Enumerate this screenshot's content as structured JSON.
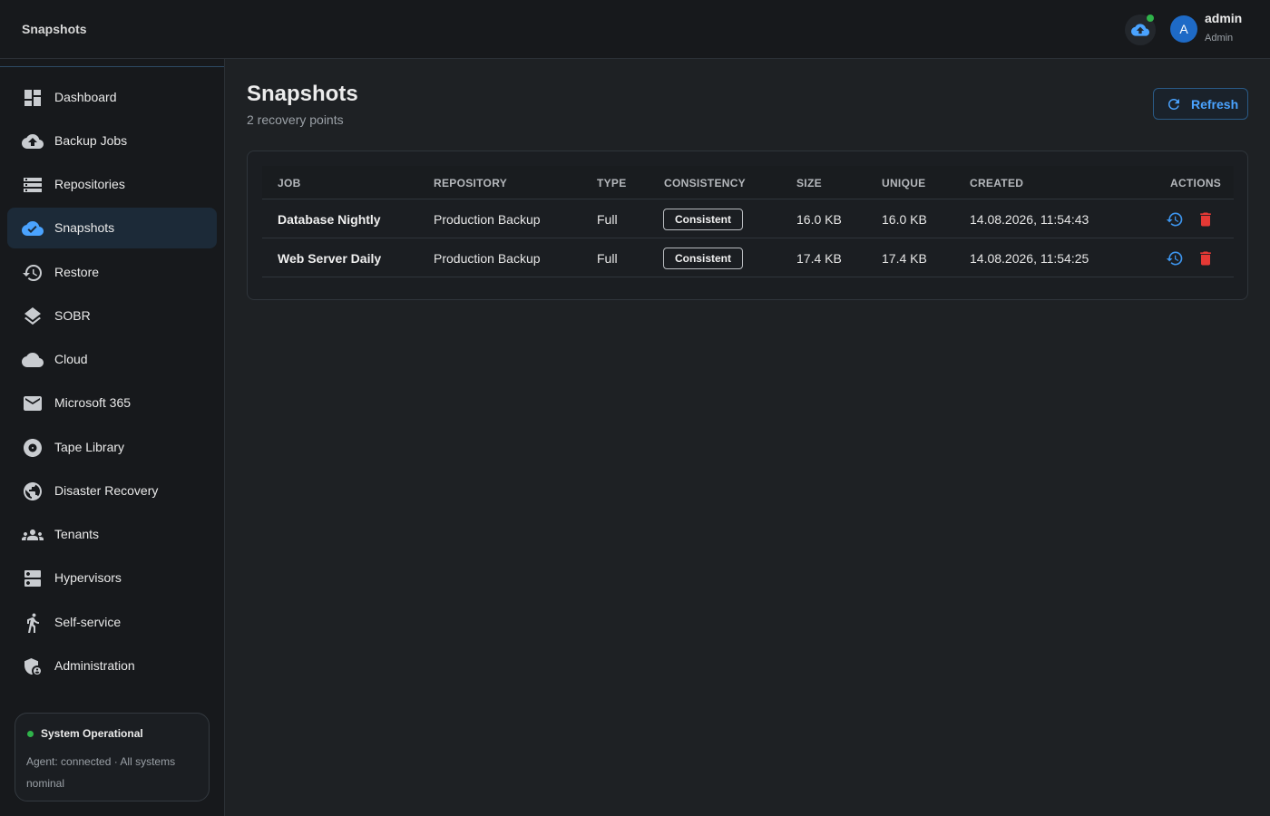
{
  "app": {
    "title": "Snapshots"
  },
  "header": {
    "user_initial": "A",
    "user_name": "admin",
    "user_role": "Admin"
  },
  "sidebar": {
    "items": [
      {
        "label": "Dashboard",
        "icon": "dashboard-icon",
        "active": false
      },
      {
        "label": "Backup Jobs",
        "icon": "cloud-upload-icon",
        "active": false
      },
      {
        "label": "Repositories",
        "icon": "storage-icon",
        "active": false
      },
      {
        "label": "Snapshots",
        "icon": "cloud-check-icon",
        "active": true
      },
      {
        "label": "Restore",
        "icon": "history-icon",
        "active": false
      },
      {
        "label": "SOBR",
        "icon": "layers-icon",
        "active": false
      },
      {
        "label": "Cloud",
        "icon": "cloud-icon",
        "active": false
      },
      {
        "label": "Microsoft 365",
        "icon": "mail-icon",
        "active": false
      },
      {
        "label": "Tape Library",
        "icon": "disc-icon",
        "active": false
      },
      {
        "label": "Disaster Recovery",
        "icon": "globe-icon",
        "active": false
      },
      {
        "label": "Tenants",
        "icon": "groups-icon",
        "active": false
      },
      {
        "label": "Hypervisors",
        "icon": "server-icon",
        "active": false
      },
      {
        "label": "Self-service",
        "icon": "person-icon",
        "active": false
      },
      {
        "label": "Administration",
        "icon": "admin-shield-icon",
        "active": false
      }
    ],
    "status": {
      "title": "System Operational",
      "description": "Agent: connected · All systems nominal"
    }
  },
  "main": {
    "title": "Snapshots",
    "subtitle": "2 recovery points",
    "refresh_label": "Refresh",
    "table": {
      "columns": [
        "JOB",
        "REPOSITORY",
        "TYPE",
        "CONSISTENCY",
        "SIZE",
        "UNIQUE",
        "CREATED",
        "ACTIONS"
      ],
      "rows": [
        {
          "job": "Database Nightly",
          "repository": "Production Backup",
          "type": "Full",
          "consistency": "Consistent",
          "size": "16.0 KB",
          "unique": "16.0 KB",
          "created": "14.08.2026, 11:54:43"
        },
        {
          "job": "Web Server Daily",
          "repository": "Production Backup",
          "type": "Full",
          "consistency": "Consistent",
          "size": "17.4 KB",
          "unique": "17.4 KB",
          "created": "14.08.2026, 11:54:25"
        }
      ]
    }
  },
  "colors": {
    "accent": "#4aa3ff",
    "danger": "#e53935",
    "success": "#2fb34a",
    "background": "#1e2124",
    "sidebar": "#17191c"
  }
}
